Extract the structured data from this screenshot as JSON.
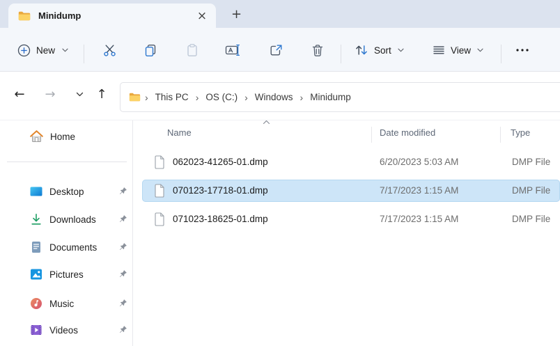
{
  "tab_bar": {
    "active_tab": {
      "title": "Minidump",
      "close_glyph": "×"
    },
    "new_tab_glyph": "+"
  },
  "toolbar": {
    "new_button": {
      "label": "New"
    },
    "sort_button": {
      "label": "Sort"
    },
    "view_button": {
      "label": "View"
    }
  },
  "address_bar": {
    "back_glyph": "←",
    "forward_glyph": "→",
    "up_glyph": "↑",
    "breadcrumb": {
      "separator": "›",
      "items": [
        "This PC",
        "OS (C:)",
        "Windows",
        "Minidump"
      ]
    }
  },
  "sidebar": {
    "items": [
      {
        "label": "Home",
        "icon": "home-icon",
        "pinned": false
      },
      {
        "label": "Desktop",
        "icon": "desktop-icon",
        "pinned": true
      },
      {
        "label": "Downloads",
        "icon": "downloads-icon",
        "pinned": true
      },
      {
        "label": "Documents",
        "icon": "documents-icon",
        "pinned": true
      },
      {
        "label": "Pictures",
        "icon": "pictures-icon",
        "pinned": true
      },
      {
        "label": "Music",
        "icon": "music-icon",
        "pinned": true
      },
      {
        "label": "Videos",
        "icon": "videos-icon",
        "pinned": true
      }
    ]
  },
  "file_list": {
    "columns": [
      {
        "label": "Name",
        "sort": "ascending"
      },
      {
        "label": "Date modified"
      },
      {
        "label": "Type"
      }
    ],
    "rows": [
      {
        "name": "062023-41265-01.dmp",
        "date_modified": "6/20/2023 5:03 AM",
        "type": "DMP File",
        "selected": false
      },
      {
        "name": "070123-17718-01.dmp",
        "date_modified": "7/17/2023 1:15 AM",
        "type": "DMP File",
        "selected": true
      },
      {
        "name": "071023-18625-01.dmp",
        "date_modified": "7/17/2023 1:15 AM",
        "type": "DMP File",
        "selected": false
      }
    ]
  },
  "colors": {
    "tab_bar_bg": "#dce3ef",
    "toolbar_bg": "#f4f7fb",
    "selection_bg": "#cde5f8",
    "accent_blue": "#2e78cf",
    "folder_yellow": "#fcd265",
    "text_primary": "#1b1b1b",
    "text_secondary": "#6d6d6d",
    "header_text": "#5e6877"
  }
}
